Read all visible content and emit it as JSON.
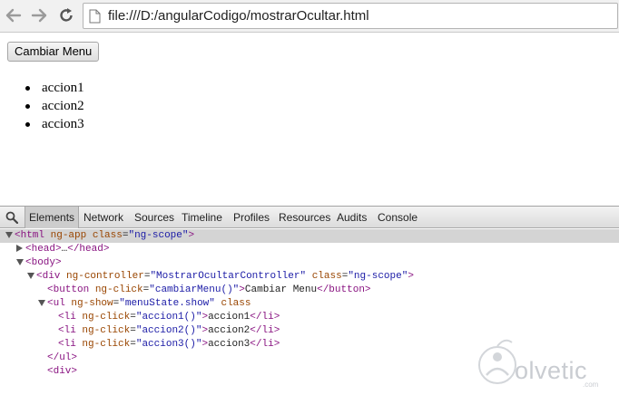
{
  "browser": {
    "url": "file:///D:/angularCodigo/mostrarOcultar.html",
    "icons": [
      "back-arrow-icon",
      "forward-arrow-icon",
      "reload-icon",
      "page-icon"
    ]
  },
  "page": {
    "button_label": "Cambiar Menu",
    "menu_items": [
      "accion1",
      "accion2",
      "accion3"
    ]
  },
  "devtools": {
    "tabs": [
      "Elements",
      "Network",
      "Sources",
      "Timeline",
      "Profiles",
      "Resources",
      "Audits",
      "Console"
    ],
    "active_tab": "Elements",
    "tree": [
      {
        "open": "<html",
        "attrs": [
          [
            "ng-app",
            null
          ],
          [
            "class",
            "ng-scope"
          ]
        ],
        "close": ">",
        "expander": "down",
        "level": 0
      },
      {
        "open": "<head>",
        "text": "…",
        "closeTag": "</head>",
        "expander": "right",
        "level": 1
      },
      {
        "open": "<body>",
        "expander": "down",
        "level": 1
      },
      {
        "open": "<div",
        "attrs": [
          [
            "ng-controller",
            "MostrarOcultarController"
          ],
          [
            "class",
            "ng-scope"
          ]
        ],
        "close": ">",
        "expander": "down",
        "level": 2
      },
      {
        "open": "<button",
        "attrs": [
          [
            "ng-click",
            "cambiarMenu()"
          ]
        ],
        "close": ">",
        "text": "Cambiar Menu",
        "closeTag": "</button>",
        "level": 3
      },
      {
        "open": "<ul",
        "attrs": [
          [
            "ng-show",
            "menuState.show"
          ],
          [
            "class",
            null
          ]
        ],
        "close": "",
        "expander": "down",
        "level": 3
      },
      {
        "open": "<li",
        "attrs": [
          [
            "ng-click",
            "accion1()"
          ]
        ],
        "close": ">",
        "text": "accion1",
        "closeTag": "</li>",
        "level": 4
      },
      {
        "open": "<li",
        "attrs": [
          [
            "ng-click",
            "accion2()"
          ]
        ],
        "close": ">",
        "text": "accion2",
        "closeTag": "</li>",
        "level": 4
      },
      {
        "open": "<li",
        "attrs": [
          [
            "ng-click",
            "accion3()"
          ]
        ],
        "close": ">",
        "text": "accion3",
        "closeTag": "</li>",
        "level": 4
      },
      {
        "open": "</ul>",
        "level": 3
      },
      {
        "open": "<div>",
        "level": 3
      }
    ]
  },
  "watermark": {
    "brand": "olvetic",
    "domain": ".com"
  }
}
